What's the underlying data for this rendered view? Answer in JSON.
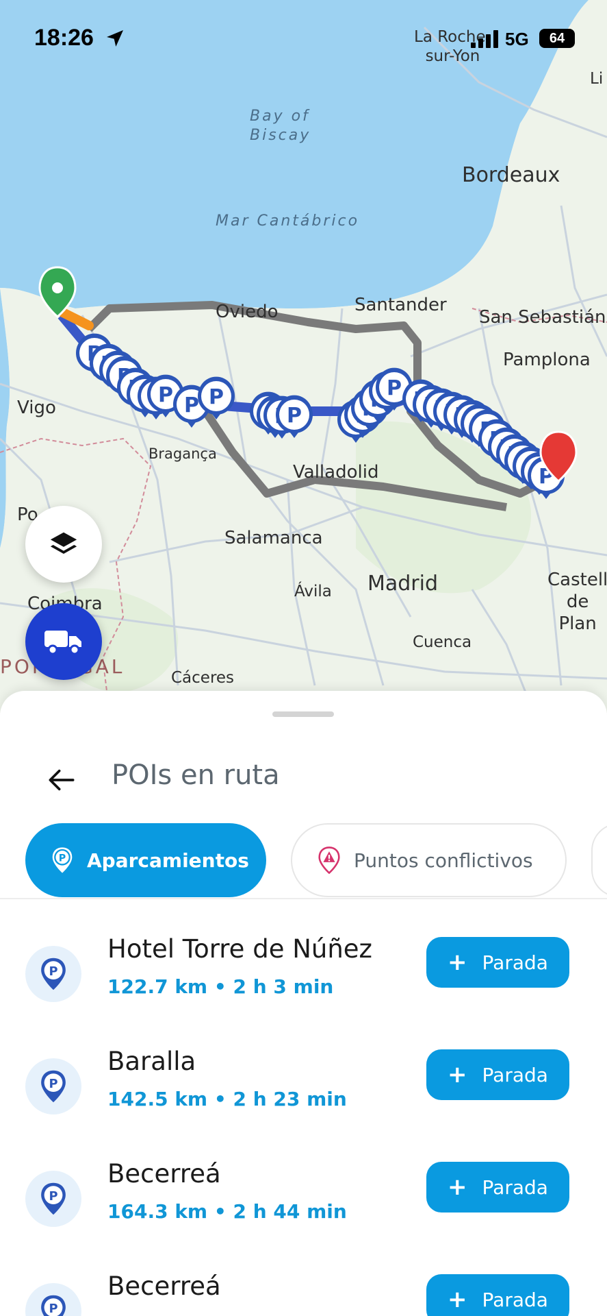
{
  "status_bar": {
    "time": "18:26",
    "network": "5G",
    "battery": "64",
    "location_icon": "location-arrow-icon",
    "signal_icon": "signal-bars-icon"
  },
  "map": {
    "cities": {
      "la_roche": "La Roche-\nsur-Yon",
      "li": "Li",
      "bordeaux": "Bordeaux",
      "oviedo": "Oviedo",
      "santander": "Santander",
      "san_sebastian": "San Sebastián",
      "pamplona": "Pamplona",
      "vigo": "Vigo",
      "braganca": "Bragança",
      "valladolid": "Valladolid",
      "po": "Po",
      "salamanca": "Salamanca",
      "avila": "Ávila",
      "madrid": "Madrid",
      "castell": "Castell\nde\nPlan",
      "coimbra": "Coimbra",
      "cuenca": "Cuenca",
      "caceres": "Cáceres"
    },
    "seas": {
      "bay_of_biscay": "Bay of\nBiscay",
      "mar_cantabrico": "Mar Cantábrico"
    },
    "country_label": "PORTUGAL",
    "route_color": "#3a58c7",
    "alt_route_color": "#888888",
    "start_marker_color": "#34a853",
    "end_marker_color": "#e53935",
    "parking_marker_letter": "P"
  },
  "map_controls": {
    "layers_icon": "layers-icon",
    "vehicle_icon": "truck-icon"
  },
  "sheet": {
    "title": "POIs en ruta",
    "back_icon": "back-arrow-icon",
    "chips": [
      {
        "label": "Aparcamientos",
        "icon": "parking-pin-icon",
        "active": true
      },
      {
        "label": "Puntos conflictivos",
        "icon": "warning-pin-icon",
        "active": false
      }
    ],
    "pois": [
      {
        "name": "Hotel Torre de Núñez",
        "meta": "122.7 km • 2 h 3 min",
        "button": "Parada"
      },
      {
        "name": "Baralla",
        "meta": "142.5 km • 2 h 23 min",
        "button": "Parada"
      },
      {
        "name": "Becerreá",
        "meta": "164.3 km • 2 h 44 min",
        "button": "Parada"
      },
      {
        "name": "Becerreá",
        "meta": "",
        "button": "Parada"
      }
    ]
  },
  "colors": {
    "accent": "#0a9ae0",
    "vehicle_button": "#1e3fcf",
    "meta_text": "#1096d6"
  }
}
